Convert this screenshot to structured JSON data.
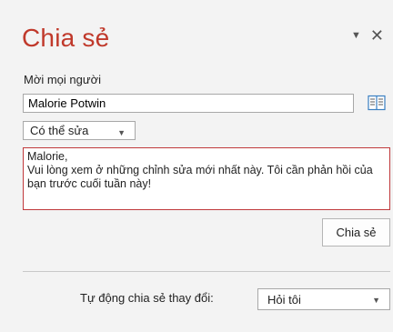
{
  "pane": {
    "title": "Chia sẻ",
    "title_color": "#c0392b"
  },
  "invite": {
    "label": "Mời mọi người",
    "value": "Malorie Potwin"
  },
  "permission": {
    "selected": "Có thể sửa"
  },
  "message": {
    "text": "Malorie,\nVui lòng xem ở những chỉnh sửa mới nhất này. Tôi cần phản hồi của bạn trước cuối tuần này!",
    "border_color": "#c0393b"
  },
  "share_button": {
    "label": "Chia sẻ"
  },
  "auto_share": {
    "label": "Tự động chia sẻ thay đổi:",
    "selected": "Hỏi tôi"
  },
  "icons": {
    "pane_options": "dropdown-arrow-icon",
    "close": "close-icon",
    "address_book": "address-book-icon"
  }
}
